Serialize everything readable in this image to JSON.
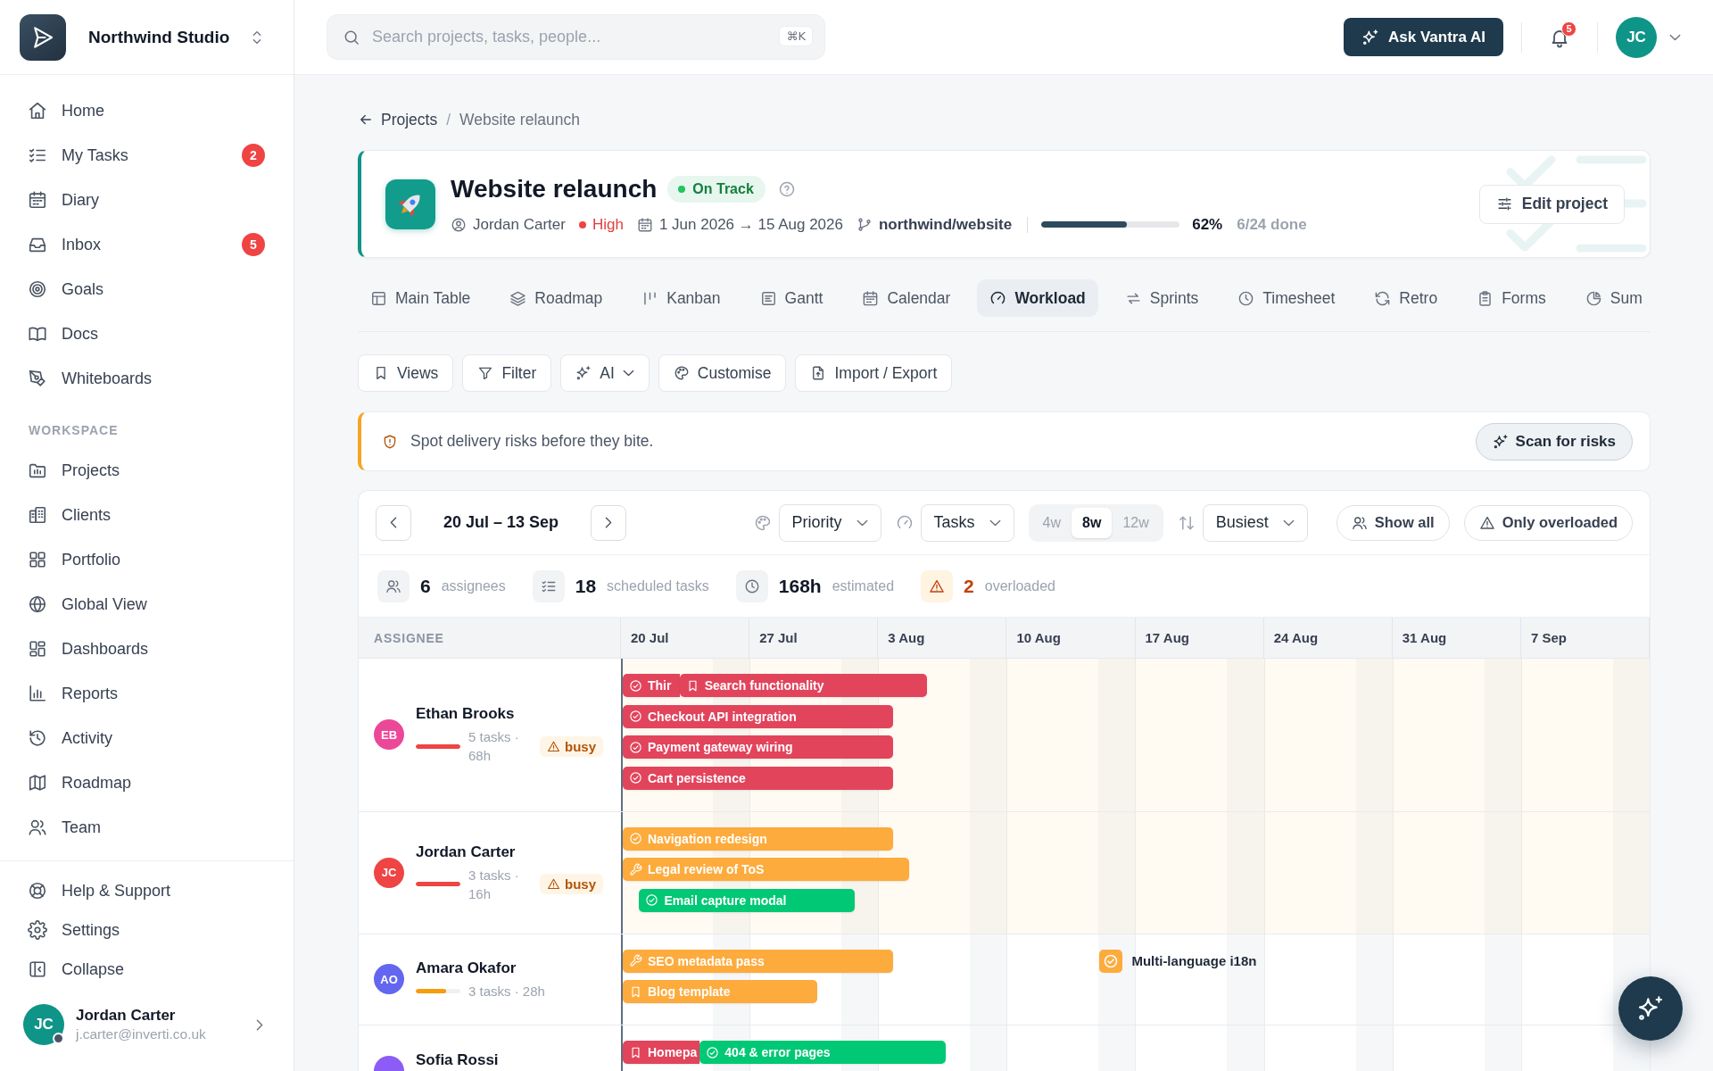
{
  "workspace": {
    "name": "Northwind Studio"
  },
  "sidebar": {
    "main_items": [
      {
        "label": "Home",
        "selected": false
      },
      {
        "label": "My Tasks",
        "badge": "2",
        "selected": false
      },
      {
        "label": "Diary",
        "selected": false
      },
      {
        "label": "Inbox",
        "badge": "5",
        "selected": false
      },
      {
        "label": "Goals",
        "selected": false
      },
      {
        "label": "Docs",
        "selected": false
      },
      {
        "label": "Whiteboards",
        "selected": false
      }
    ],
    "section_title": "WORKSPACE",
    "workspace_items": [
      {
        "label": "Projects",
        "selected": false
      },
      {
        "label": "Clients",
        "selected": false
      },
      {
        "label": "Portfolio",
        "selected": false
      },
      {
        "label": "Global View",
        "selected": false
      },
      {
        "label": "Dashboards",
        "selected": false
      },
      {
        "label": "Reports",
        "selected": false
      },
      {
        "label": "Activity",
        "selected": false
      },
      {
        "label": "Roadmap",
        "selected": false
      },
      {
        "label": "Team",
        "selected": false
      }
    ],
    "footer_items": [
      {
        "label": "Help & Support"
      },
      {
        "label": "Settings"
      },
      {
        "label": "Collapse"
      }
    ],
    "user": {
      "initials": "JC",
      "name": "Jordan Carter",
      "email": "j.carter@inverti.co.uk",
      "online": true
    }
  },
  "top_bar": {
    "search": {
      "placeholder": "Search projects, tasks, people...",
      "shortcut": "⌘K"
    },
    "ai_button": "Ask Vantra AI",
    "notification_count": "5",
    "avatar": "JC"
  },
  "breadcrumb": {
    "parent": "Projects",
    "separator": "/",
    "current": "Website relaunch"
  },
  "project": {
    "title": "Website relaunch",
    "status": "On Track",
    "owner": "Jordan Carter",
    "priority": "High",
    "dates": "1 Jun 2026 → 15 Aug 2026",
    "repository": "northwind/website",
    "level": 0.62,
    "percent": "62%",
    "done": "6/24 done",
    "edit_button": "Edit project"
  },
  "view_tabs": [
    {
      "label": "Main Table",
      "selected": false
    },
    {
      "label": "Roadmap",
      "selected": false
    },
    {
      "label": "Kanban",
      "selected": false
    },
    {
      "label": "Gantt",
      "selected": false
    },
    {
      "label": "Calendar",
      "selected": false
    },
    {
      "label": "Workload",
      "selected": true
    },
    {
      "label": "Sprints",
      "selected": false
    },
    {
      "label": "Timesheet",
      "selected": false
    },
    {
      "label": "Retro",
      "selected": false
    },
    {
      "label": "Forms",
      "selected": false
    },
    {
      "label": "Sum",
      "selected": false
    }
  ],
  "toolbar": [
    {
      "label": "Views",
      "kind": "button"
    },
    {
      "label": "Filter",
      "kind": "button"
    },
    {
      "label": "AI",
      "kind": "menu"
    },
    {
      "label": "Customise",
      "kind": "button"
    },
    {
      "label": "Import / Export",
      "kind": "button"
    }
  ],
  "banner": {
    "message": "Spot delivery risks before they bite.",
    "action": "Scan for risks"
  },
  "workload": {
    "range": "20 Jul – 13 Sep",
    "color_by": "Priority",
    "measure": "Tasks",
    "spans": [
      {
        "label": "4w",
        "selected": false
      },
      {
        "label": "8w",
        "selected": true
      },
      {
        "label": "12w",
        "selected": false
      }
    ],
    "sort": "Busiest",
    "filters": [
      {
        "label": "Show all",
        "kind": "people"
      },
      {
        "label": "Only overloaded",
        "kind": "alert"
      }
    ],
    "stats": [
      {
        "value": "6",
        "label": "assignees",
        "kind": "people"
      },
      {
        "value": "18",
        "label": "scheduled tasks",
        "kind": "tasks"
      },
      {
        "value": "168h",
        "label": "estimated",
        "kind": "time"
      },
      {
        "value": "2",
        "label": "overloaded",
        "kind": "alert"
      }
    ],
    "assignee_column": "ASSIGNEE",
    "weeks": [
      "20 Jul",
      "27 Jul",
      "3 Aug",
      "10 Aug",
      "17 Aug",
      "24 Aug",
      "31 Aug",
      "7 Sep"
    ],
    "assignees": [
      {
        "initials": "EB",
        "name": "Ethan Brooks",
        "color": "#ec4899",
        "level": 1,
        "meta": "5 tasks · 68h",
        "overloaded": true,
        "badge": "busy",
        "tasks": [
          {
            "title": "Thir",
            "kind": "task",
            "color": "#e2445c"
          },
          {
            "title": "Search functionality",
            "kind": "story",
            "color": "#e2445c"
          },
          {
            "title": "Checkout API integration",
            "kind": "task",
            "color": "#e2445c"
          },
          {
            "title": "Payment gateway wiring",
            "kind": "task",
            "color": "#e2445c"
          },
          {
            "title": "Cart persistence",
            "kind": "task",
            "color": "#e2445c"
          }
        ]
      },
      {
        "initials": "JC",
        "name": "Jordan Carter",
        "color": "#ef4444",
        "level": 1,
        "meta": "3 tasks · 16h",
        "overloaded": true,
        "badge": "busy",
        "tasks": [
          {
            "title": "Navigation redesign",
            "kind": "task",
            "color": "#fdab3d"
          },
          {
            "title": "Legal review of ToS",
            "kind": "fix",
            "color": "#fdab3d"
          },
          {
            "title": "Email capture modal",
            "kind": "task",
            "color": "#00c875"
          }
        ]
      },
      {
        "initials": "AO",
        "name": "Amara Okafor",
        "color": "#6366f1",
        "level": 0.68,
        "meta": "3 tasks · 28h",
        "overloaded": false,
        "tasks": [
          {
            "title": "SEO metadata pass",
            "kind": "fix",
            "color": "#fdab3d"
          },
          {
            "title": "Blog template",
            "kind": "story",
            "color": "#fdab3d"
          },
          {
            "title": "Multi-language i18n",
            "kind": "milestone",
            "color": "#fdab3d"
          }
        ]
      },
      {
        "name": "Sofia Rossi",
        "color": "#8b5cf6",
        "overloaded": false,
        "tasks": [
          {
            "title": "Homepa",
            "kind": "story",
            "color": "#e2445c"
          },
          {
            "title": "404 & error pages",
            "kind": "task",
            "color": "#00c875"
          }
        ]
      }
    ]
  }
}
